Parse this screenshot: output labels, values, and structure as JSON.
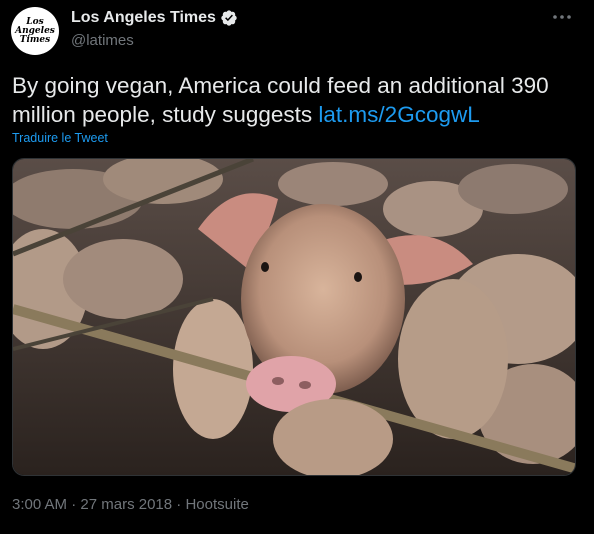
{
  "account": {
    "display_name": "Los Angeles Times",
    "handle": "@latimes",
    "avatar_lines": [
      "Los",
      "Angeles",
      "Times"
    ]
  },
  "tweet": {
    "text": "By going vegan, America could feed an additional 390 million people, study suggests ",
    "link": "lat.ms/2GcogwL",
    "translate_label": "Traduire le Tweet",
    "time": "3:00 AM",
    "date": "27 mars 2018",
    "source": "Hootsuite",
    "separator": "·"
  },
  "media": {
    "description": "Pigs in a pen, one pig looking at the camera"
  },
  "icons": {
    "verified": "verified-badge-icon",
    "more": "more-options-icon"
  },
  "colors": {
    "background": "#000000",
    "text": "#e7e9ea",
    "secondary": "#71767b",
    "link": "#1d9bf0",
    "verified": "#e7e9ea"
  }
}
